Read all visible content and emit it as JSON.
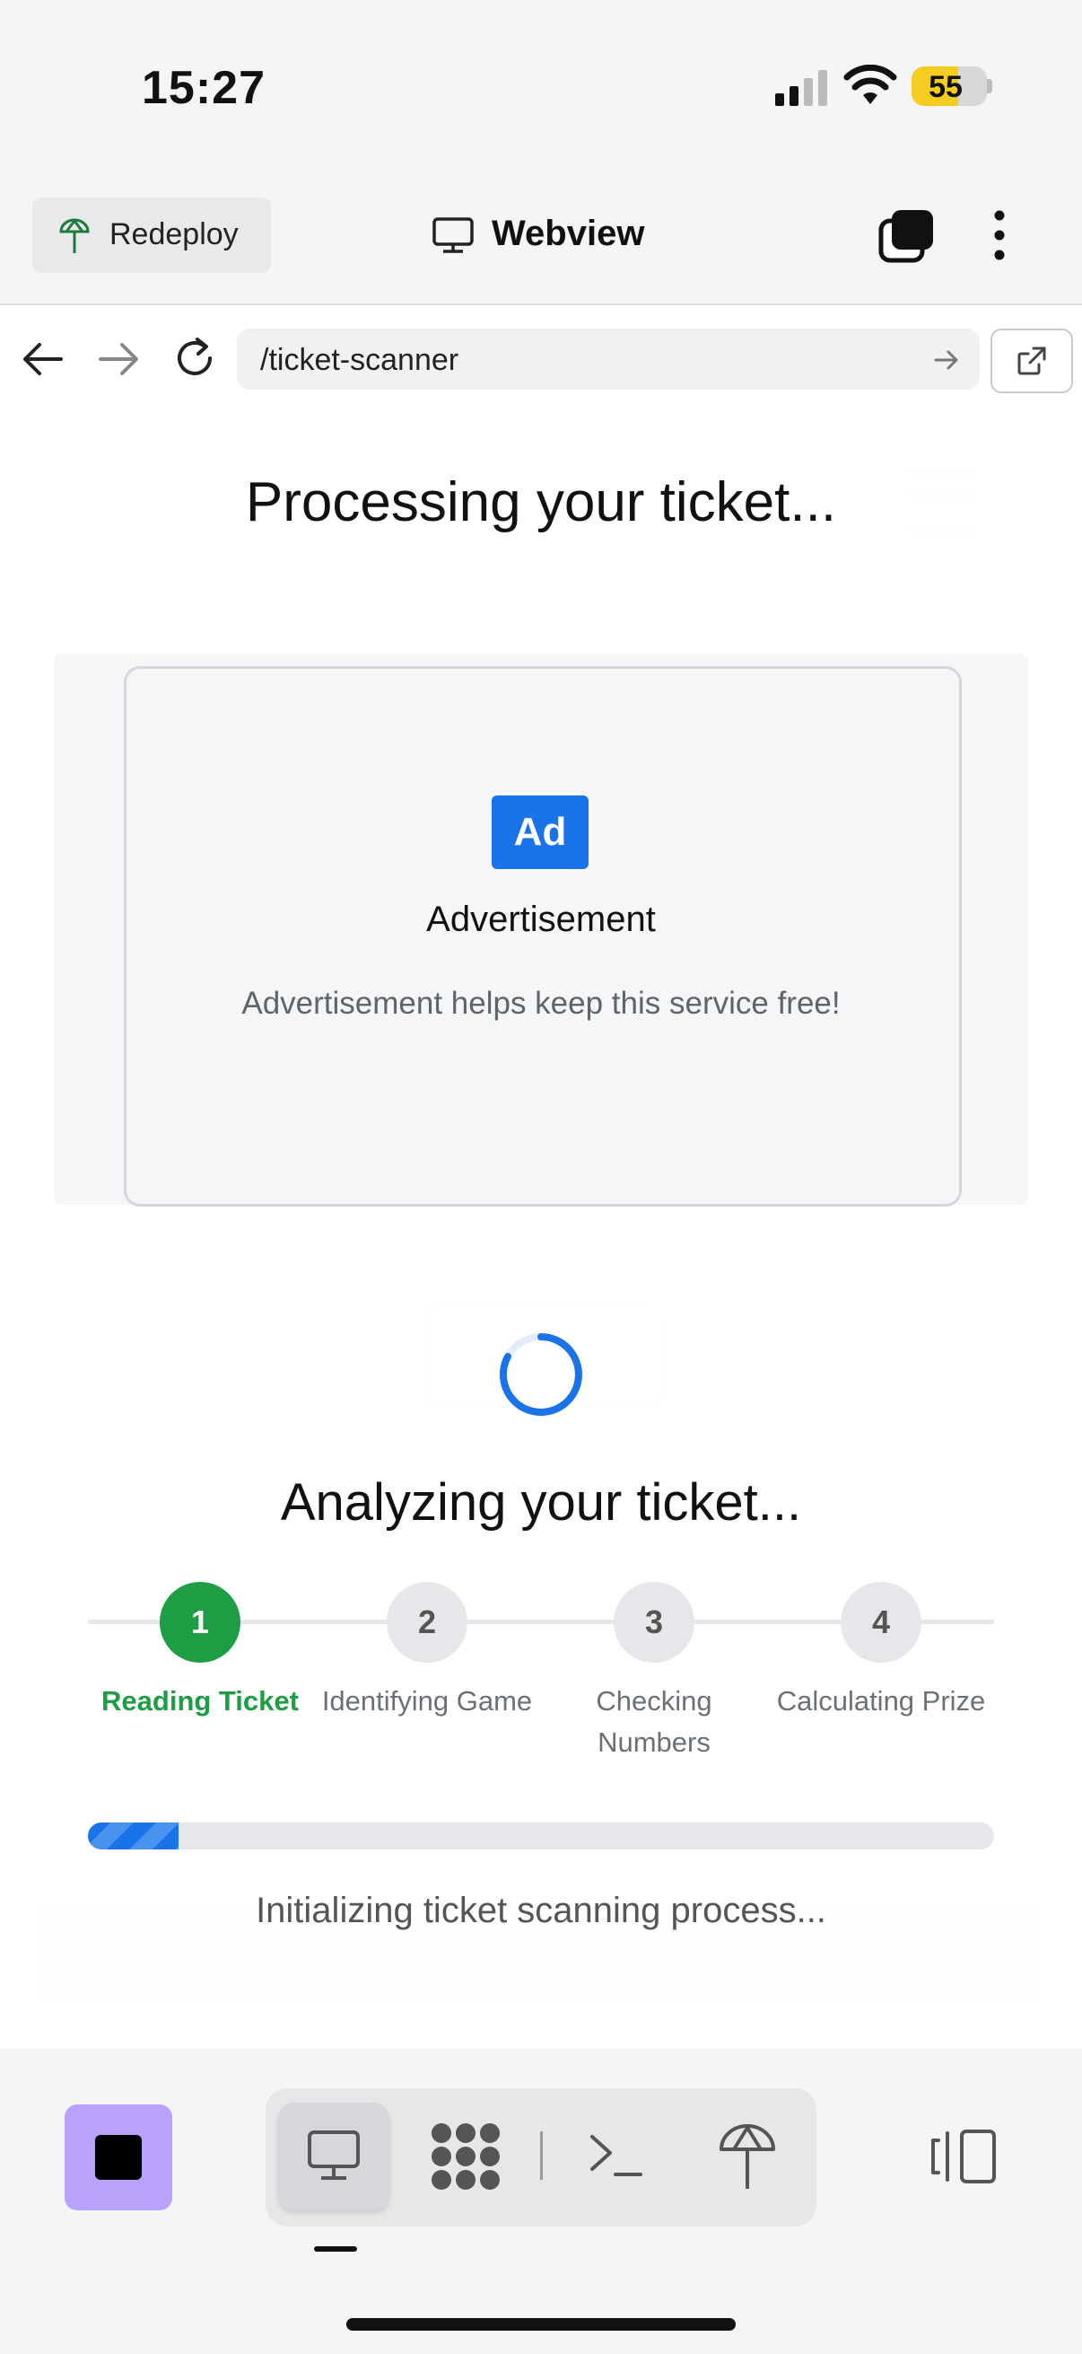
{
  "status_bar": {
    "time": "15:27",
    "battery": "55"
  },
  "top_bar": {
    "redeploy_label": "Redeploy",
    "title": "Webview"
  },
  "url_bar": {
    "path": "/ticket-scanner"
  },
  "page": {
    "processing_title": "Processing your ticket...",
    "ad": {
      "icon_text": "Ad",
      "title": "Advertisement",
      "description": "Advertisement helps keep this service free!"
    },
    "analyzing_title": "Analyzing your ticket...",
    "steps": [
      {
        "number": "1",
        "label": "Reading Ticket",
        "active": true
      },
      {
        "number": "2",
        "label": "Identifying Game",
        "active": false
      },
      {
        "number": "3",
        "label": "Checking Numbers",
        "active": false
      },
      {
        "number": "4",
        "label": "Calculating Prize",
        "active": false
      }
    ],
    "progress_fraction": 0.1,
    "progress_text": "Initializing ticket scanning process..."
  },
  "colors": {
    "accent_blue": "#1a73e8",
    "step_active_green": "#1f9d45",
    "stop_button_purple": "#b9a2fb",
    "battery_yellow": "#f4cd20"
  },
  "icons": [
    "signal-icon",
    "wifi-icon",
    "battery-icon",
    "deploy-tree-icon",
    "monitor-icon",
    "tabs-icon",
    "more-vertical-icon",
    "back-arrow-icon",
    "forward-arrow-icon",
    "reload-icon",
    "go-arrow-icon",
    "external-link-icon",
    "ad-icon",
    "spinner-icon",
    "stop-icon",
    "dots-grid-icon",
    "terminal-icon",
    "split-view-icon"
  ]
}
